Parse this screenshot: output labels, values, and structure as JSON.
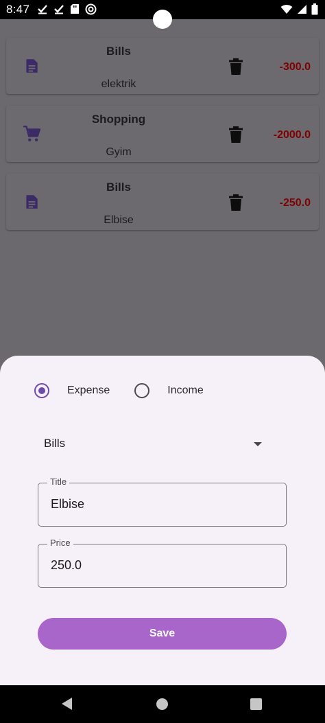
{
  "status_bar": {
    "time": "8:47",
    "left_icons": [
      "check-icon",
      "check-icon",
      "sd-card-icon",
      "vpn-icon"
    ],
    "right_icons": [
      "wifi-icon",
      "signal-icon",
      "battery-icon"
    ]
  },
  "transactions": [
    {
      "icon": "receipt-icon",
      "category": "Bills",
      "title": "elektrik",
      "amount": "-300.0"
    },
    {
      "icon": "cart-icon",
      "category": "Shopping",
      "title": "Gyim",
      "amount": "-2000.0"
    },
    {
      "icon": "receipt-icon",
      "category": "Bills",
      "title": "Elbise",
      "amount": "-250.0"
    }
  ],
  "form": {
    "type_options": {
      "expense_label": "Expense",
      "income_label": "Income",
      "selected": "Expense"
    },
    "category_value": "Bills",
    "title_label": "Title",
    "title_value": "Elbise",
    "price_label": "Price",
    "price_value": "250.0",
    "save_label": "Save"
  },
  "colors": {
    "accent": "#6f4ba8",
    "button": "#a866cb",
    "amount_negative": "#7e0000",
    "sheet_background": "#f6f1f8",
    "scrim_background": "#6b696d"
  }
}
